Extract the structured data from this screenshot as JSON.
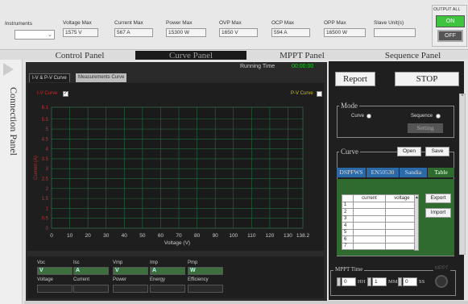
{
  "topbar": {
    "instruments_label": "Instruments",
    "voltage_max_label": "Voltage Max",
    "voltage_max": "1575 V",
    "current_max_label": "Current Max",
    "current_max": "567 A",
    "power_max_label": "Power Max",
    "power_max": "15300 W",
    "ovp_max_label": "OVP Max",
    "ovp_max": "1650 V",
    "ocp_max_label": "OCP Max",
    "ocp_max": "594 A",
    "opp_max_label": "OPP Max",
    "opp_max": "16500 W",
    "slave_units_label": "Slave Unit(s)",
    "slave_units": "",
    "output_all_label": "OUTPUT ALL",
    "on_label": "ON",
    "off_label": "OFF"
  },
  "tabs": [
    "Control Panel",
    "Curve Panel",
    "MPPT Panel",
    "Sequence Panel"
  ],
  "left_panel_label": "Connection Panel",
  "running_time_label": "Running Time",
  "running_time": "00:00:00",
  "subtabs": [
    "I-V & P-V Curve",
    "Measurements Curve"
  ],
  "iv_curve_label": "I-V Curve",
  "pv_curve_label": "P-V Curve",
  "colors": {
    "accent_green": "#3ec43e",
    "grid_green": "#1f6e3f",
    "iv_red": "#c03030",
    "pv_yellow": "#c8c020"
  },
  "chart_data": {
    "type": "line",
    "ylabel": "Current (A)",
    "xlabel": "Voltage (V)",
    "xlim": [
      0,
      138.2
    ],
    "ylim": [
      0,
      6.1
    ],
    "x_ticks": [
      "0",
      "10",
      "20",
      "30",
      "40",
      "50",
      "60",
      "70",
      "80",
      "90",
      "100",
      "110",
      "120",
      "130",
      "138.2"
    ],
    "y_ticks": [
      "6.1",
      "5.5",
      "5",
      "4.5",
      "4",
      "3.5",
      "3",
      "2.5",
      "2",
      "1.5",
      "1",
      "0.5",
      "0"
    ],
    "series": []
  },
  "measurements": {
    "row1_labels": [
      "Voc",
      "Isc",
      "Vmp",
      "Imp",
      "Pmp"
    ],
    "row1_values": [
      "V",
      "A",
      "V",
      "A",
      "W"
    ],
    "row2_labels": [
      "Voltage",
      "Current",
      "Power",
      "Energy",
      "Efficiency"
    ]
  },
  "right": {
    "report_label": "Report",
    "stop_label": "STOP",
    "mode_label": "Mode",
    "curve_radio_label": "Curve",
    "sequence_radio_label": "Sequence",
    "setting_label": "Setting",
    "curve_label": "Curve",
    "open_label": "Open",
    "save_label": "Save",
    "curve_tabs": [
      "DSPFWS",
      "EN50530",
      "Sandia",
      "Table"
    ],
    "table_headers": [
      "",
      "current",
      "voltage"
    ],
    "table_rows": [
      "1",
      "2",
      "3",
      "4",
      "5",
      "6",
      "7"
    ],
    "export_label": "Export",
    "import_label": "Import",
    "mppt_time_label": "MPPT Time",
    "mppt_label": "MPPT",
    "hh_value": "0",
    "hh_label": "HH",
    "mm_value": "1",
    "mm_label": "MM",
    "ss_value": "0",
    "ss_label": "SS"
  }
}
